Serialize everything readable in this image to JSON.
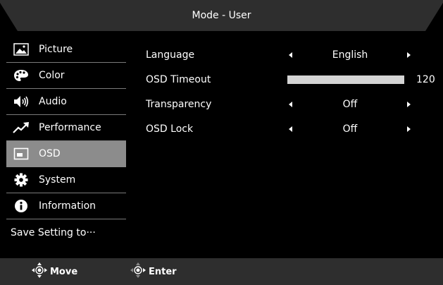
{
  "header": {
    "title": "Mode - User"
  },
  "sidebar": {
    "items": [
      {
        "label": "Picture",
        "icon": "picture-icon",
        "active": false
      },
      {
        "label": "Color",
        "icon": "palette-icon",
        "active": false
      },
      {
        "label": "Audio",
        "icon": "speaker-icon",
        "active": false
      },
      {
        "label": "Performance",
        "icon": "trend-arrow-icon",
        "active": false
      },
      {
        "label": "OSD",
        "icon": "osd-window-icon",
        "active": true
      },
      {
        "label": "System",
        "icon": "gear-icon",
        "active": false
      },
      {
        "label": "Information",
        "icon": "info-icon",
        "active": false
      }
    ],
    "save_label": "Save Setting to···"
  },
  "settings": [
    {
      "label": "Language",
      "type": "select",
      "value": "English"
    },
    {
      "label": "OSD Timeout",
      "type": "slider",
      "value": "120",
      "fill_fraction": 1.0
    },
    {
      "label": "Transparency",
      "type": "select",
      "value": "Off"
    },
    {
      "label": "OSD Lock",
      "type": "select",
      "value": "Off"
    }
  ],
  "footer": {
    "move_label": "Move",
    "enter_label": "Enter"
  },
  "colors": {
    "background": "#000000",
    "active_item": "#8c8c8c",
    "footer": "#2e2e2e",
    "slider_fill": "#d4d4d4"
  }
}
